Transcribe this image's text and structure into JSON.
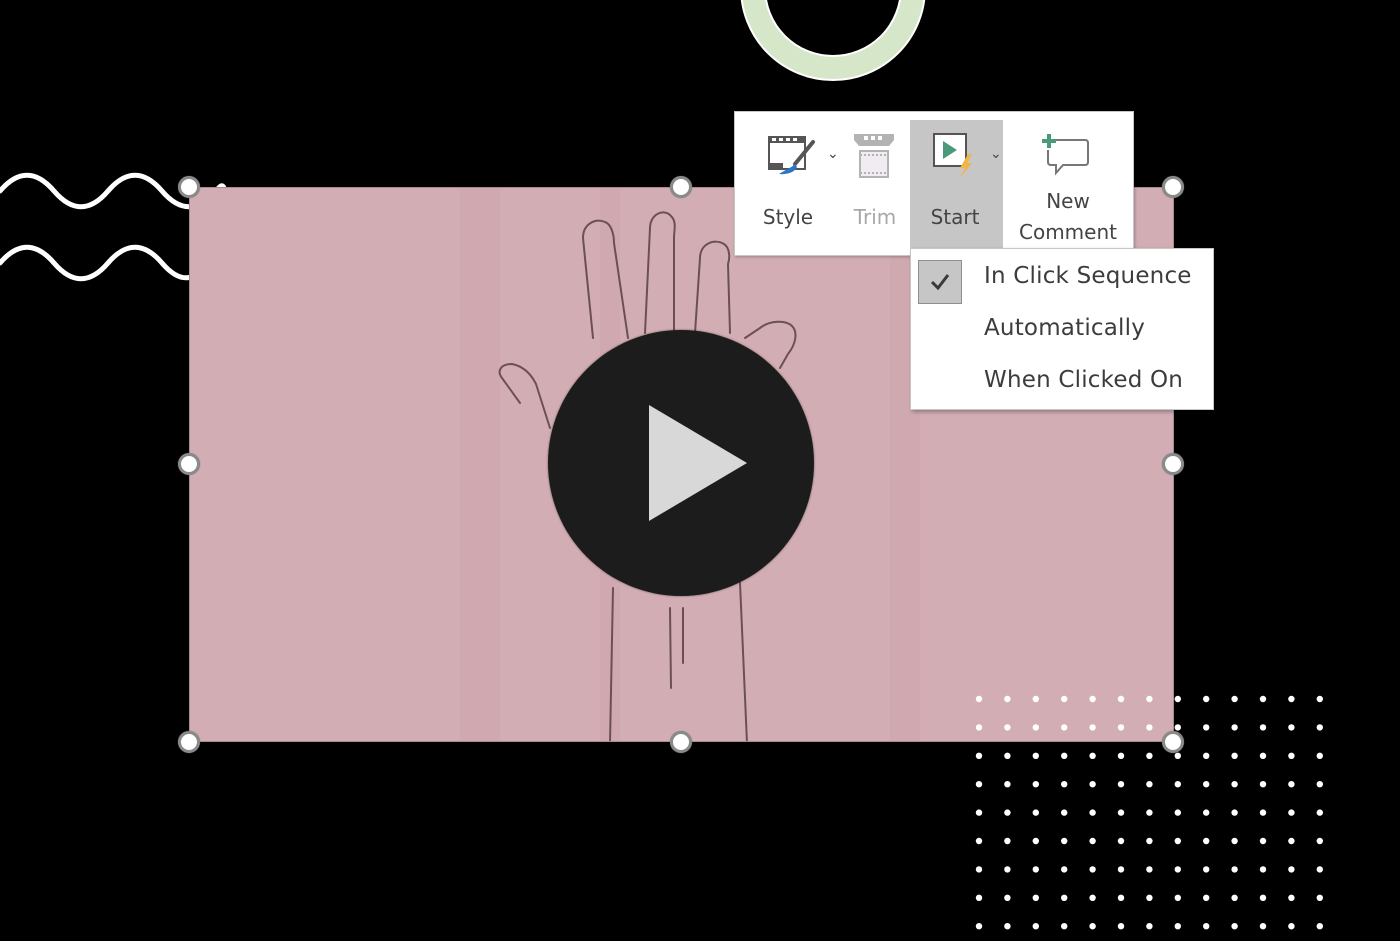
{
  "slide": {
    "background_color": "#000000",
    "ring_color": "#d5e6c9",
    "video_fill_color": "#d2aeb4",
    "video": {
      "type": "video-placeholder",
      "play_icon": "play-icon",
      "thumbnail": "sketch of a raised hand"
    },
    "decorations": {
      "waves_icon": "wavy-lines",
      "dot_grid": {
        "columns": 13,
        "rows": 9
      }
    }
  },
  "toolbar": {
    "buttons": [
      {
        "id": "style",
        "label": "Style",
        "icon": "video-style-icon",
        "has_dropdown": true,
        "enabled": true,
        "active": false
      },
      {
        "id": "trim",
        "label": "Trim",
        "icon": "trim-video-icon",
        "has_dropdown": false,
        "enabled": false,
        "active": false
      },
      {
        "id": "start",
        "label": "Start",
        "icon": "start-play-icon",
        "has_dropdown": true,
        "enabled": true,
        "active": true
      },
      {
        "id": "new_comment",
        "label_line1": "New",
        "label_line2": "Comment",
        "icon": "new-comment-icon",
        "has_dropdown": false,
        "enabled": true,
        "active": false
      }
    ]
  },
  "start_menu": {
    "items": [
      {
        "label": "In Click Sequence",
        "checked": true
      },
      {
        "label": "Automatically",
        "checked": false
      },
      {
        "label": "When Clicked On",
        "checked": false
      }
    ],
    "check_icon": "checkmark-icon"
  }
}
